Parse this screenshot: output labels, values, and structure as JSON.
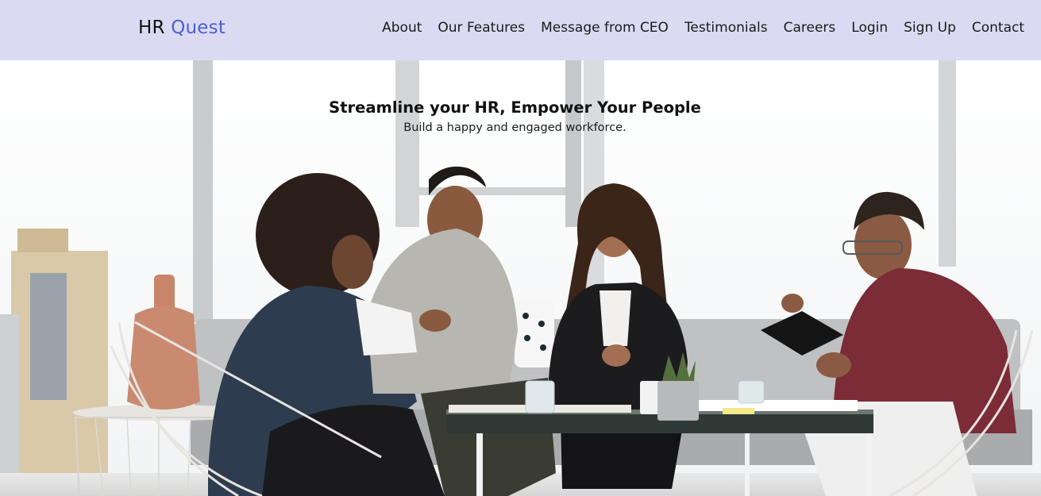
{
  "brand": {
    "name_part1": "HR",
    "name_part2": "Quest"
  },
  "nav": {
    "items": [
      {
        "label": "About"
      },
      {
        "label": "Our Features"
      },
      {
        "label": "Message from CEO"
      },
      {
        "label": "Testimonials"
      },
      {
        "label": "Careers"
      },
      {
        "label": "Login"
      },
      {
        "label": "Sign Up"
      },
      {
        "label": "Contact"
      }
    ]
  },
  "hero": {
    "title": "Streamline your HR, Empower Your People",
    "subtitle": "Build a happy and engaged workforce."
  },
  "colors": {
    "navbar_bg": "#dcdaf2",
    "brand_accent": "#4a5fd6",
    "text": "#111111"
  }
}
